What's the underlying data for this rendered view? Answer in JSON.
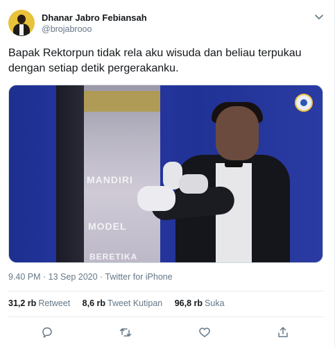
{
  "tweet": {
    "author_name": "Dhanar Jabro Febiansah",
    "author_handle": "@brojabrooo",
    "text": "Bapak Rektorpun tidak rela aku wisuda dan beliau terpukau dengan setiap detik pergerakanku.",
    "meta": "9.40 PM · 13 Sep 2020 · Twitter for iPhone",
    "media": {
      "banner_texts": [
        "MANDIRI",
        "MODEL",
        "BERETIKA"
      ]
    },
    "stats": [
      {
        "count": "31,2 rb",
        "label": "Retweet"
      },
      {
        "count": "8,6 rb",
        "label": "Tweet Kutipan"
      },
      {
        "count": "96,8 rb",
        "label": "Suka"
      }
    ],
    "actions": [
      "reply-icon",
      "retweet-icon",
      "like-icon",
      "share-icon"
    ],
    "colors": {
      "text": "#14171a",
      "muted": "#657786",
      "divider": "#e6ecf0"
    }
  }
}
